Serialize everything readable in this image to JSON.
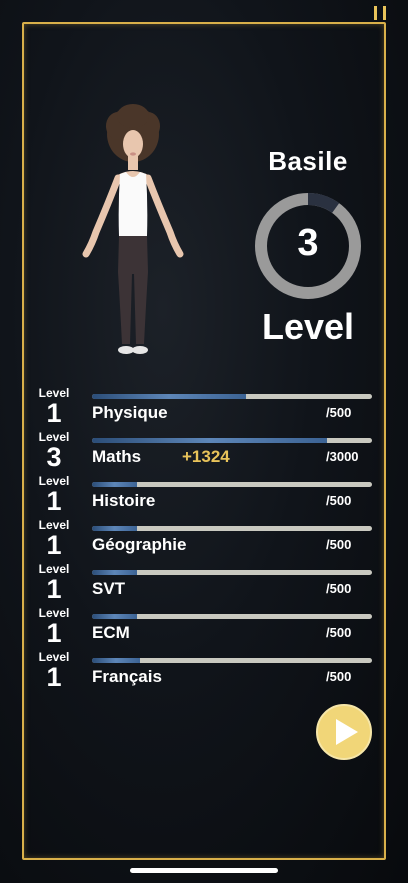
{
  "player": {
    "name": "Basile",
    "level": "3",
    "level_word": "Level",
    "ring_progress": 0.1
  },
  "subjects": [
    {
      "level_label": "Level",
      "level": "1",
      "name": "Physique",
      "max": "/500",
      "progress": 0.55,
      "gain": ""
    },
    {
      "level_label": "Level",
      "level": "3",
      "name": "Maths",
      "max": "/3000",
      "progress": 0.84,
      "gain": "+1324"
    },
    {
      "level_label": "Level",
      "level": "1",
      "name": "Histoire",
      "max": "/500",
      "progress": 0.16,
      "gain": ""
    },
    {
      "level_label": "Level",
      "level": "1",
      "name": "Géographie",
      "max": "/500",
      "progress": 0.16,
      "gain": ""
    },
    {
      "level_label": "Level",
      "level": "1",
      "name": "SVT",
      "max": "/500",
      "progress": 0.16,
      "gain": ""
    },
    {
      "level_label": "Level",
      "level": "1",
      "name": "ECM",
      "max": "/500",
      "progress": 0.16,
      "gain": ""
    },
    {
      "level_label": "Level",
      "level": "1",
      "name": "Français",
      "max": "/500",
      "progress": 0.17,
      "gain": ""
    }
  ],
  "icons": {
    "pause": "pause-icon",
    "play": "play-icon"
  },
  "colors": {
    "accent_gold": "#e8c35a",
    "frame_gold": "#d9b04a",
    "bar_blue": "#5d86b8",
    "bar_track": "#c9c9c0"
  }
}
